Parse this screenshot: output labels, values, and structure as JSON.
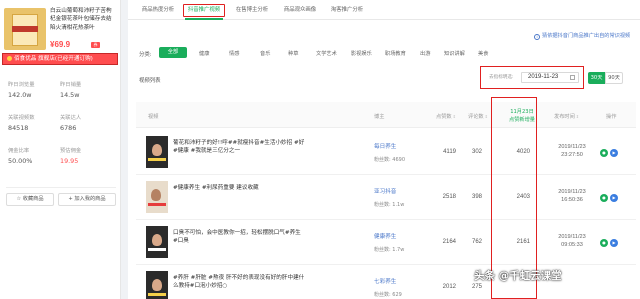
{
  "product": {
    "title": "白云山葡萄和沛籽子苦枸杞金银花茶叶包储存去结陷火清柑花热茶叶",
    "price": "¥69.9",
    "tag": "券",
    "store_bar": "佰食优品 旗舰店(已经开通订购)"
  },
  "stats": [
    {
      "label": "昨日浏览量",
      "value": "142.0w"
    },
    {
      "label": "昨日销量",
      "value": "14.5w"
    },
    {
      "label": "关联视频数",
      "value": "84518"
    },
    {
      "label": "关联达人",
      "value": "6786"
    },
    {
      "label": "佣金比率",
      "value": "50.00%"
    },
    {
      "label": "预估佣金",
      "value": "19.95"
    }
  ],
  "left_buttons": {
    "favorite": "收藏商品",
    "add": "加入我的商品"
  },
  "tabs": [
    "商品热度分析",
    "抖音推广视频",
    "在售博主分析",
    "商品观众画像",
    "淘客推广分析"
  ],
  "notice": "猜依据抖音门商品推广出自的常识视频",
  "category": {
    "label": "分类:",
    "items": [
      "全部",
      "健康",
      "情感",
      "音乐",
      "种草",
      "文学艺术",
      "影视娱乐",
      "职场教育",
      "出游",
      "知识讲解",
      "美食"
    ]
  },
  "list_label": "视频列表",
  "date_filter": {
    "label": "去指标明选:",
    "value": "2019-11-23",
    "btn_30": "30天",
    "btn_90": "90天"
  },
  "table": {
    "headers": {
      "video": "视频",
      "blogger": "博主",
      "likes": "点赞数",
      "comments": "评论数",
      "views_date": "11月23日",
      "views_label": "点赞新增量",
      "time": "发布时间",
      "action": "操作"
    },
    "rows": [
      {
        "title": "葡花和沛籽子的好!!呼##就瘦抖音#生活小妙招 #好 #健康 #我就是三亿分之一",
        "blogger": "每日养生",
        "fans": "粉丝数: 4690",
        "likes": "4119",
        "comments": "302",
        "views": "4020",
        "date": "2019/11/23",
        "clock": "23:27:50"
      },
      {
        "title": "#健康养生 #利尿药重要 建议收藏",
        "blogger": "亚习抖音",
        "fans": "粉丝数: 1.1w",
        "likes": "2518",
        "comments": "398",
        "views": "2403",
        "date": "2019/11/23",
        "clock": "16:50:36"
      },
      {
        "title": "口臭不可怕，会中医教你一招，轻松摆脱口气#养生 #口臭",
        "blogger": "健康养生",
        "fans": "粉丝数: 1.7w",
        "likes": "2164",
        "comments": "762",
        "views": "2161",
        "date": "2019/11/23",
        "clock": "09:05:33"
      },
      {
        "title": "#养肝 #肝脏 #熬夜 肝不好的表现没有好的肝中建什么教持#口泡小妙招○",
        "blogger": "七彩养生",
        "fans": "粉丝数: 629",
        "likes": "2012",
        "comments": "275",
        "views": "",
        "date": "",
        "clock": ""
      }
    ]
  },
  "watermark": "头条 @千虹云课堂"
}
